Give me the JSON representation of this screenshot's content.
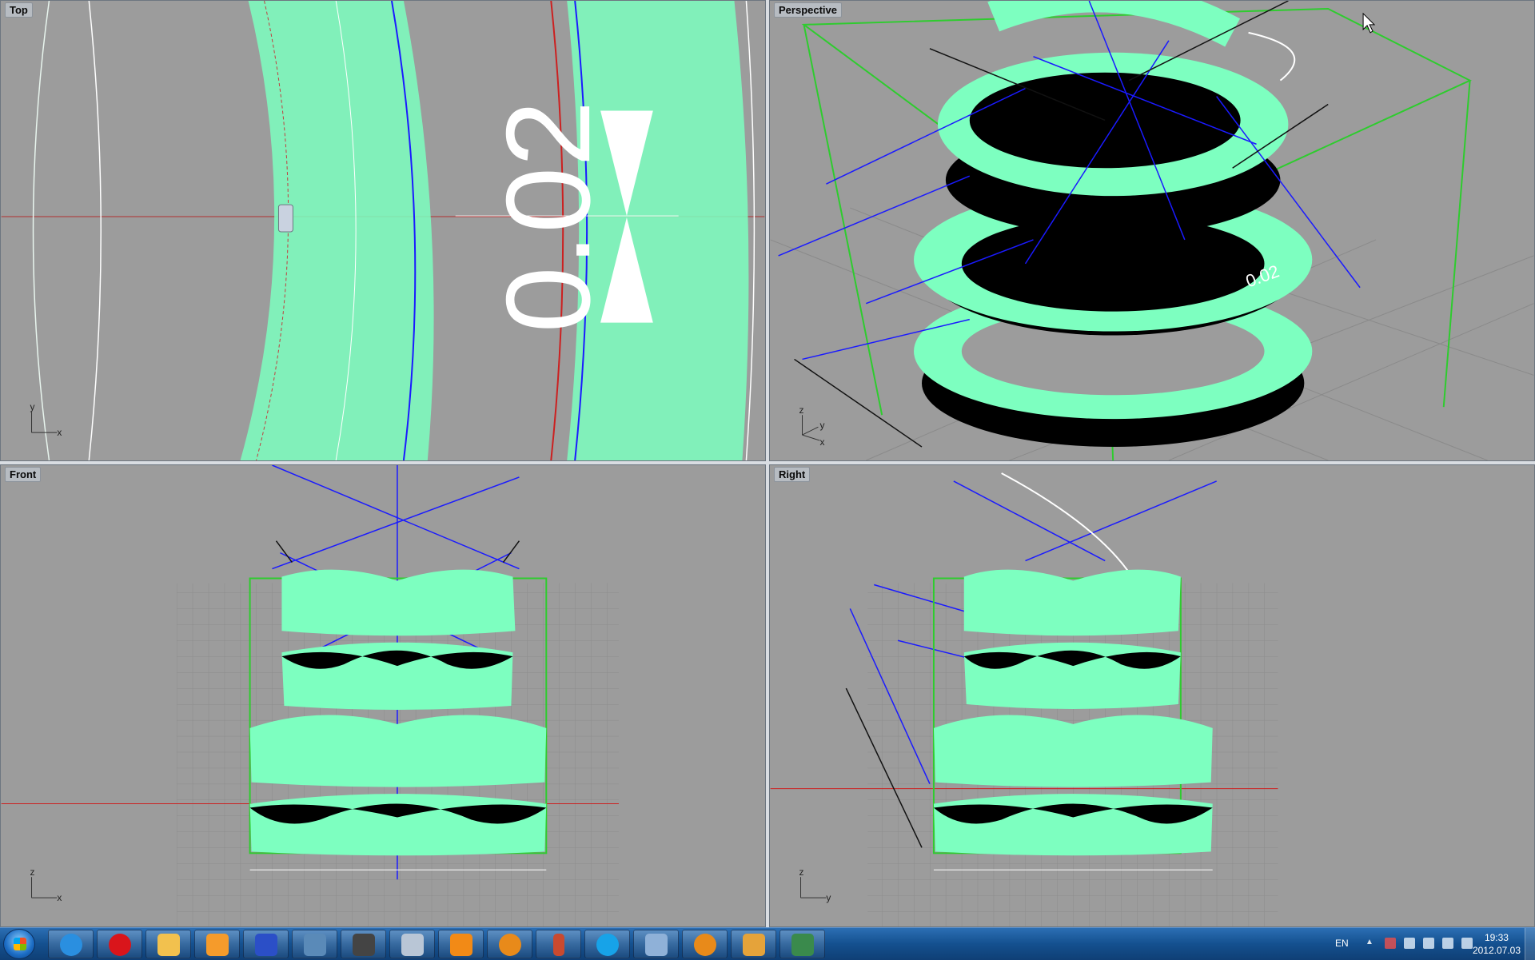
{
  "viewports": {
    "top": {
      "label": "Top",
      "axis_x": "x",
      "axis_y": "y",
      "dimension_text": "0.02"
    },
    "perspective": {
      "label": "Perspective",
      "axis_x": "x",
      "axis_y": "y",
      "axis_z": "z",
      "dimension_text": "0.02"
    },
    "front": {
      "label": "Front",
      "axis_x": "x",
      "axis_z": "z"
    },
    "right": {
      "label": "Right",
      "axis_y": "y",
      "axis_z": "z"
    }
  },
  "colors": {
    "viewport_bg": "#9c9c9c",
    "mint_surface": "#7dffc0",
    "black_surface": "#000000",
    "blue_curve": "#1a1aff",
    "green_bbox": "#2ecc2e",
    "red_axis": "#cc2020"
  },
  "taskbar": {
    "apps": [
      {
        "name": "internet-explorer-icon"
      },
      {
        "name": "opera-icon"
      },
      {
        "name": "file-explorer-icon"
      },
      {
        "name": "media-player-icon"
      },
      {
        "name": "save-disk-icon"
      },
      {
        "name": "photo-viewer-icon"
      },
      {
        "name": "rhino-icon"
      },
      {
        "name": "calculator-icon"
      },
      {
        "name": "vlc-icon"
      },
      {
        "name": "app-v-icon"
      },
      {
        "name": "hourglass-icon"
      },
      {
        "name": "skype-icon"
      },
      {
        "name": "computer-icon"
      },
      {
        "name": "app-v-icon-2"
      },
      {
        "name": "package-icon"
      },
      {
        "name": "monitor-icon"
      }
    ],
    "language": "EN",
    "time": "19:33",
    "date": "2012.07.03"
  }
}
